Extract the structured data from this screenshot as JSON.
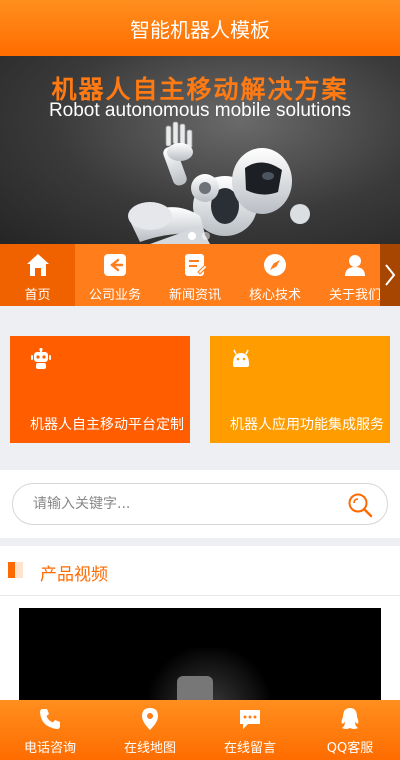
{
  "header": {
    "title": "智能机器人模板"
  },
  "banner": {
    "headline_cn": "机器人自主移动解决方案",
    "headline_en": "Robot autonomous mobile solutions",
    "slide_count": 2,
    "active_slide": 1
  },
  "nav": {
    "items": [
      {
        "label": "首页",
        "icon": "home-icon",
        "active": true
      },
      {
        "label": "公司业务",
        "icon": "back-arrow-square-icon"
      },
      {
        "label": "新闻资讯",
        "icon": "document-edit-icon"
      },
      {
        "label": "核心技术",
        "icon": "compass-icon"
      },
      {
        "label": "关于我们",
        "icon": "user-icon"
      }
    ],
    "more_icon": "chevron-right-icon"
  },
  "cards": [
    {
      "text": "机器人自主移动平台定制",
      "icon": "robot-icon",
      "color": "#ff5d00"
    },
    {
      "text": "机器人应用功能集成服务",
      "icon": "android-icon",
      "color": "#ff9c00"
    }
  ],
  "search": {
    "placeholder": "请输入关键字...",
    "value": ""
  },
  "products": {
    "title": "产品视频"
  },
  "footer": {
    "items": [
      {
        "label": "电话咨询",
        "icon": "phone-icon"
      },
      {
        "label": "在线地图",
        "icon": "map-pin-icon"
      },
      {
        "label": "在线留言",
        "icon": "chat-icon"
      },
      {
        "label": "QQ客服",
        "icon": "qq-icon"
      }
    ]
  },
  "colors": {
    "brand": "#ff7d1a",
    "accent": "#ff6a00"
  }
}
